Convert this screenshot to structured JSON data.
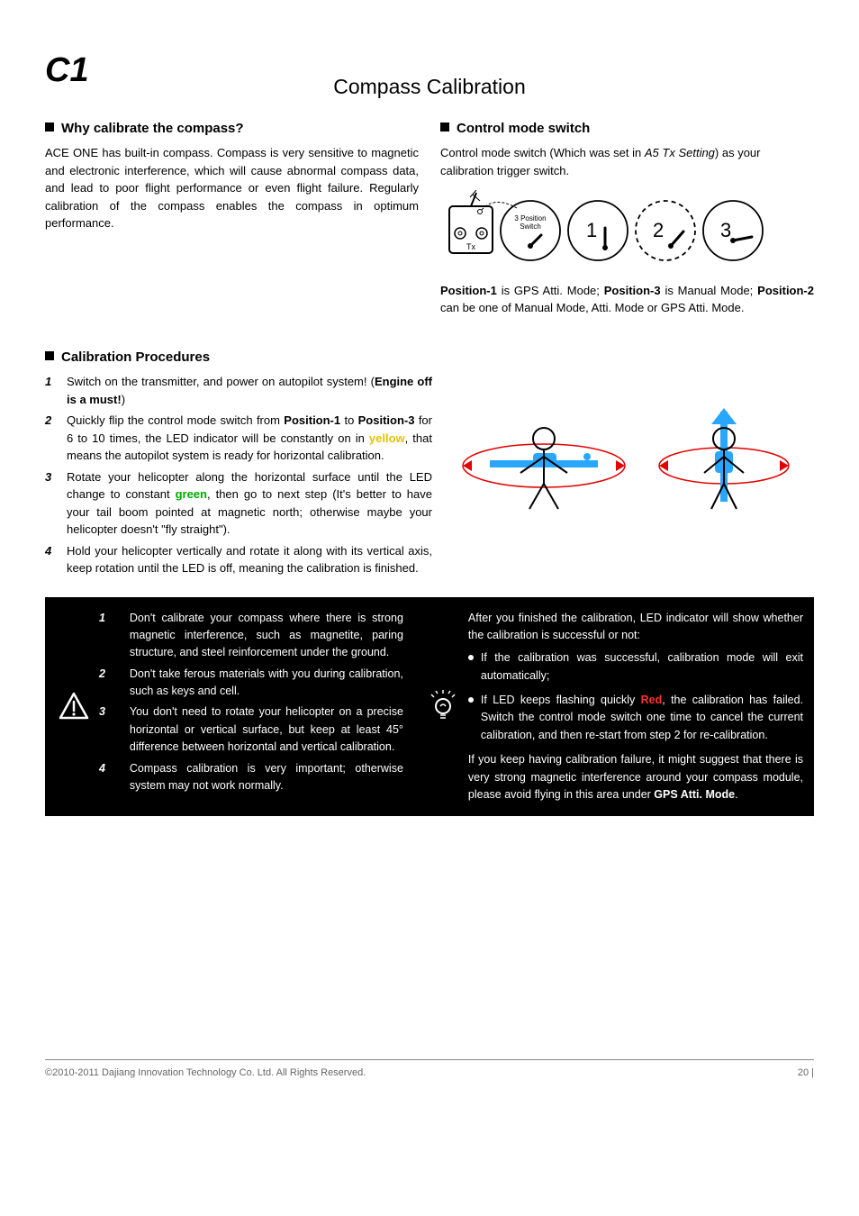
{
  "section_label": "C1",
  "title": "Compass Calibration",
  "why": {
    "heading": "Why calibrate the compass?",
    "body": "ACE ONE has built-in compass. Compass is very sensitive to magnetic and electronic interference, which will cause abnormal compass data, and lead to poor flight performance or even flight failure. Regularly calibration of the compass enables the compass in optimum performance."
  },
  "switch": {
    "heading": "Control mode switch",
    "p1": "Control mode switch (Which was set in",
    "p1_ref": "A5 Tx Setting",
    "p1_tail": ") as your calibration trigger switch.",
    "diagram": {
      "tx_label": "Tx",
      "sw_label": "3 Position Switch",
      "positions": [
        "1",
        "2",
        "3"
      ]
    },
    "p2_prefix": "Position-1",
    "p2_mid": " is GPS Atti. Mode; ",
    "p2_pos3": "Position-3",
    "p2_tail1": " is Manual Mode; ",
    "p2_pos2": "Position-2",
    "p2_tail2": " can be one of Manual Mode, Atti. Mode or GPS Atti. Mode."
  },
  "procedures": {
    "heading": "Calibration Procedures",
    "items": [
      {
        "num": "1",
        "text_prefix": "Switch on the transmitter, and power on autopilot system! (",
        "text_bold": "Engine off is a must!",
        "text_tail": ")"
      },
      {
        "num": "2",
        "text_prefix": "Quickly flip the control mode switch from ",
        "text_bold": "Position-1",
        "text_mid": " to ",
        "text_bold2": "Position-3",
        "text_mid2": " for 6 to 10 times, the LED indicator will be constantly on in ",
        "text_color": "yellow",
        "text_tail": ", that means the autopilot system is ready for horizontal calibration."
      },
      {
        "num": "3",
        "text_prefix": "Rotate your helicopter along the horizontal surface until the LED change to constant ",
        "text_color": "green",
        "text_mid": ", then go to next step (It's better to have your tail boom pointed at magnetic north; otherwise maybe your helicopter doesn't \"fly straight\")."
      },
      {
        "num": "4",
        "text_prefix": "Hold your helicopter vertically and rotate it along with its vertical axis, keep rotation until the LED is off, meaning the calibration is finished."
      }
    ]
  },
  "tips_left": {
    "items": [
      {
        "num": "1",
        "text": "Don't calibrate your compass where there is strong magnetic interference, such as magnetite, paring structure, and steel reinforcement under the ground."
      },
      {
        "num": "2",
        "text": "Don't take ferous materials with you during calibration, such as keys and cell."
      },
      {
        "num": "3",
        "text": "You don't need to rotate your helicopter on a precise horizontal or vertical surface, but keep at least 45° difference between horizontal and vertical calibration."
      },
      {
        "num": "4",
        "text": "Compass calibration is very important; otherwise system may not work normally."
      }
    ]
  },
  "tips_right": {
    "lead": "After you finished the calibration, LED indicator will show whether the calibration is successful or not:",
    "bullets": [
      "If the calibration was successful, calibration mode will exit automatically;",
      {
        "prefix": "If LED keeps flashing quickly ",
        "red_word": "Red",
        "tail": ", the calibration has failed. Switch the control mode switch one time to cancel the current calibration, and then re-start from step 2 for re-calibration."
      }
    ],
    "note_prefix": "If you keep having calibration failure, it might suggest that there is very strong magnetic interference around your compass module, please avoid flying in this area under ",
    "note_bold": "GPS Atti. Mode",
    "note_tail": "."
  },
  "footer": {
    "copyright": "©2010-2011 Dajiang Innovation Technology Co. Ltd. All Rights Reserved.",
    "page": "20 |"
  }
}
